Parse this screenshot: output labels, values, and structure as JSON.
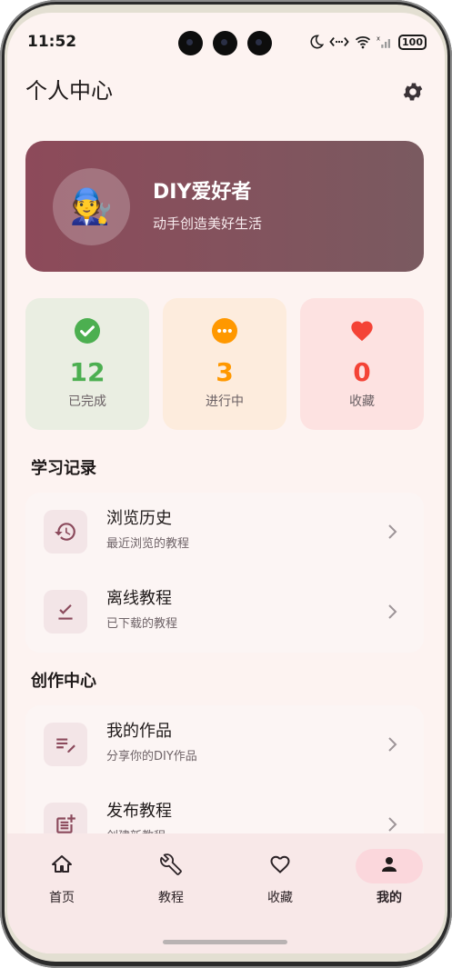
{
  "status_bar": {
    "time": "11:52",
    "battery": "100"
  },
  "header": {
    "title": "个人中心"
  },
  "profile": {
    "avatar_emoji": "🧑‍🔧",
    "name": "DIY爱好者",
    "motto": "动手创造美好生活"
  },
  "stats": [
    {
      "value": "12",
      "label": "已完成",
      "color": "#4caf50",
      "bg": "#eaeee2",
      "icon": "check-circle-icon"
    },
    {
      "value": "3",
      "label": "进行中",
      "color": "#ff9800",
      "bg": "#fdecdd",
      "icon": "more-circle-icon"
    },
    {
      "value": "0",
      "label": "收藏",
      "color": "#f44336",
      "bg": "#fde2e1",
      "icon": "heart-icon"
    }
  ],
  "sections": {
    "learning": {
      "title": "学习记录",
      "items": [
        {
          "title": "浏览历史",
          "subtitle": "最近浏览的教程",
          "icon": "history-icon"
        },
        {
          "title": "离线教程",
          "subtitle": "已下载的教程",
          "icon": "download-done-icon"
        }
      ]
    },
    "creation": {
      "title": "创作中心",
      "items": [
        {
          "title": "我的作品",
          "subtitle": "分享你的DIY作品",
          "icon": "edit-note-icon"
        },
        {
          "title": "发布教程",
          "subtitle": "创建新教程",
          "icon": "post-add-icon"
        }
      ]
    }
  },
  "bottom_nav": [
    {
      "label": "首页",
      "icon": "home-icon"
    },
    {
      "label": "教程",
      "icon": "wrench-icon"
    },
    {
      "label": "收藏",
      "icon": "heart-outline-icon"
    },
    {
      "label": "我的",
      "icon": "person-icon",
      "selected": true
    }
  ],
  "colors": {
    "accent": "#8b4a5c",
    "background": "#fdf3f1",
    "nav_selected": "#fbd7dc"
  }
}
